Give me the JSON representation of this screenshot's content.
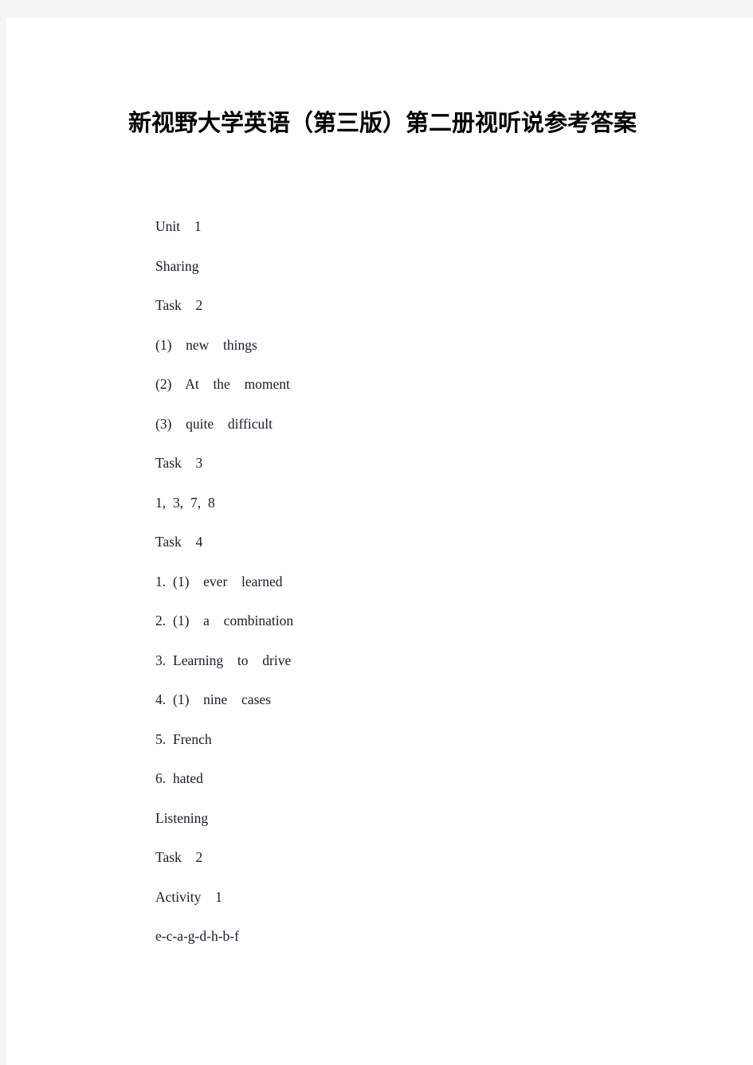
{
  "document": {
    "title": "新视野大学英语（第三版）第二册视听说参考答案",
    "page_background": "#ffffff",
    "canvas_background": "#f4f4f5",
    "text_color": "#1b1b26",
    "lines": [
      {
        "id": "unit-heading",
        "text": "Unit  1"
      },
      {
        "id": "section-sharing",
        "text": "Sharing"
      },
      {
        "id": "sharing-task-2",
        "text": "Task  2"
      },
      {
        "id": "sharing-task2-a1",
        "text": "(1)  new  things"
      },
      {
        "id": "sharing-task2-a2",
        "text": "(2)  At  the  moment"
      },
      {
        "id": "sharing-task2-a3",
        "text": "(3)  quite  difficult"
      },
      {
        "id": "sharing-task-3",
        "text": "Task  3"
      },
      {
        "id": "sharing-task3-a1",
        "text": "1, 3, 7, 8"
      },
      {
        "id": "sharing-task-4",
        "text": "Task  4"
      },
      {
        "id": "sharing-task4-a1",
        "text": "1. (1)  ever  learned"
      },
      {
        "id": "sharing-task4-a2",
        "text": "2. (1)  a  combination"
      },
      {
        "id": "sharing-task4-a3",
        "text": "3. Learning  to  drive"
      },
      {
        "id": "sharing-task4-a4",
        "text": "4. (1)  nine  cases"
      },
      {
        "id": "sharing-task4-a5",
        "text": "5. French"
      },
      {
        "id": "sharing-task4-a6",
        "text": "6. hated"
      },
      {
        "id": "section-listening",
        "text": "Listening"
      },
      {
        "id": "listening-task-2",
        "text": "Task  2"
      },
      {
        "id": "listening-activity-1",
        "text": "Activity  1"
      },
      {
        "id": "listening-act1-a1",
        "text": "e-c-a-g-d-h-b-f"
      }
    ]
  }
}
